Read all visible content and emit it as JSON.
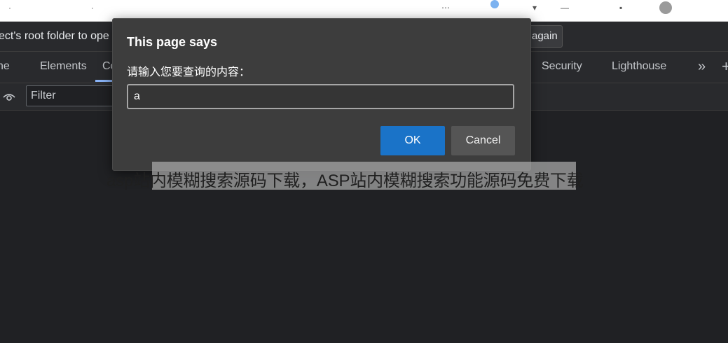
{
  "browser": {
    "infobar_text": "ect's root folder to ope",
    "infobar_button": "again"
  },
  "devtools": {
    "tabs": [
      {
        "label": "ne"
      },
      {
        "label": "Elements"
      },
      {
        "label": "Co"
      },
      {
        "label": "Security"
      },
      {
        "label": "Lighthouse"
      }
    ],
    "active_tab": "Co",
    "more_tabs_icon": "chevron-double-right-icon",
    "add_tab_icon": "plus-icon",
    "filter": {
      "placeholder": "Filter",
      "icon": "eye-icon"
    }
  },
  "dialog": {
    "title": "This page says",
    "message": "请输入您要查询的内容：",
    "input_value": "a",
    "ok_label": "OK",
    "cancel_label": "Cancel"
  },
  "watermark": {
    "caption": "asp站内模糊搜索源码下载，ASP站内模糊搜索功能源码免费下载"
  },
  "colors": {
    "background": "#202124",
    "panel": "#292a2d",
    "dialog": "#3d3d3d",
    "ok_button": "#1a73c8",
    "cancel_button": "#555555"
  }
}
